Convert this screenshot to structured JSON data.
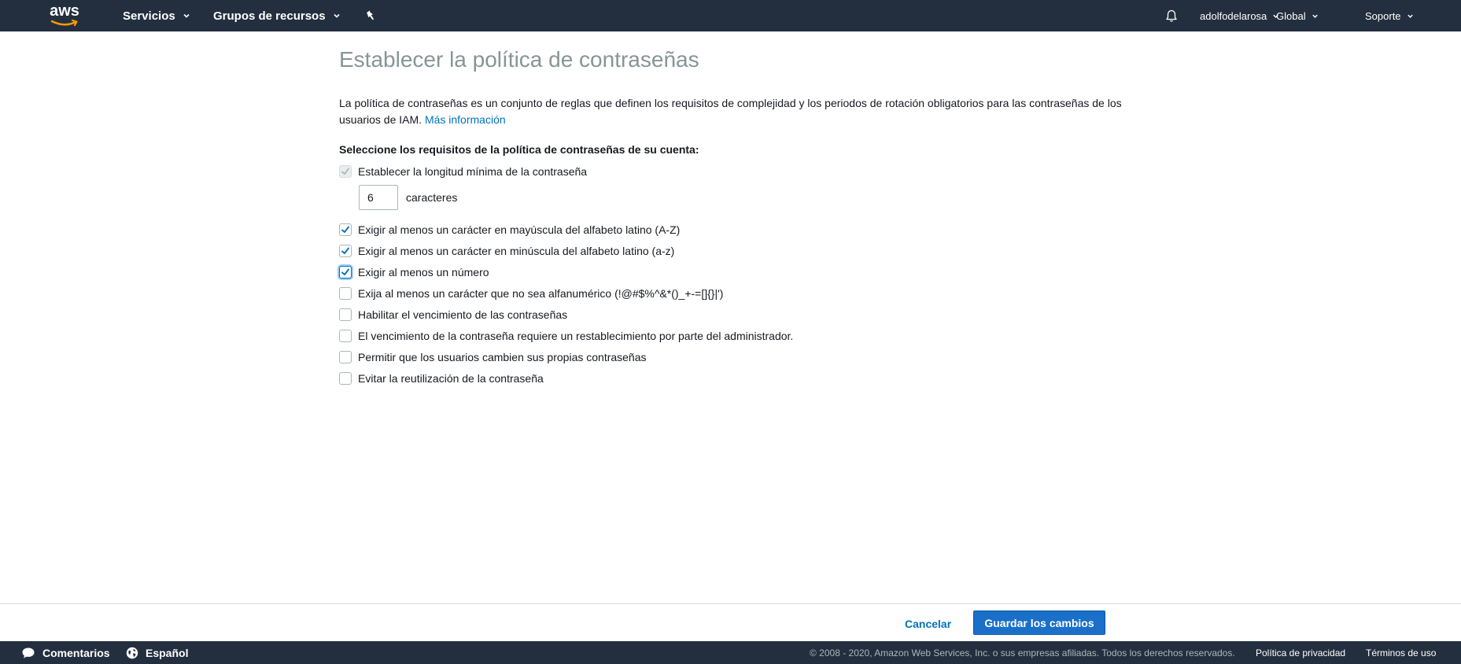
{
  "topbar": {
    "logo_text": "aws",
    "services_label": "Servicios",
    "resource_groups_label": "Grupos de recursos",
    "user_label": "adolfodelarosa",
    "region_label": "Global",
    "support_label": "Soporte"
  },
  "page": {
    "title": "Establecer la política de contraseñas",
    "intro_text": "La política de contraseñas es un conjunto de reglas que definen los requisitos de complejidad y los periodos de rotación obligatorios para las contraseñas de los usuarios de IAM. ",
    "learn_more_label": "Más información",
    "section_heading": "Seleccione los requisitos de la política de contraseñas de su cuenta:"
  },
  "options": {
    "min_length": {
      "label": "Establecer la longitud mínima de la contraseña",
      "checked": true,
      "disabled": true
    },
    "min_length_value": "6",
    "min_length_unit": "caracteres",
    "uppercase": {
      "label": "Exigir al menos un carácter en mayúscula del alfabeto latino (A-Z)",
      "checked": true
    },
    "lowercase": {
      "label": "Exigir al menos un carácter en minúscula del alfabeto latino (a-z)",
      "checked": true
    },
    "number": {
      "label": "Exigir al menos un número",
      "checked": true
    },
    "symbol": {
      "label": "Exija al menos un carácter que no sea alfanumérico (!@#$%^&*()_+-=[]{}|')",
      "checked": false
    },
    "expiration": {
      "label": "Habilitar el vencimiento de las contraseñas",
      "checked": false
    },
    "admin_reset": {
      "label": "El vencimiento de la contraseña requiere un restablecimiento por parte del administrador.",
      "checked": false
    },
    "allow_change": {
      "label": "Permitir que los usuarios cambien sus propias contraseñas",
      "checked": false
    },
    "prevent_reuse": {
      "label": "Evitar la reutilización de la contraseña",
      "checked": false
    }
  },
  "actions": {
    "cancel_label": "Cancelar",
    "save_label": "Guardar los cambios"
  },
  "footer": {
    "feedback_label": "Comentarios",
    "language_label": "Español",
    "copyright": "© 2008 - 2020, Amazon Web Services, Inc. o sus empresas afiliadas. Todos los derechos reservados.",
    "privacy_label": "Política de privacidad",
    "terms_label": "Términos de uso"
  },
  "colors": {
    "nav_bg": "#232f3e",
    "link": "#0073bb",
    "primary_button": "#1a6fc9",
    "checkbox_check": "#0073bb",
    "title_gray": "#879596"
  }
}
